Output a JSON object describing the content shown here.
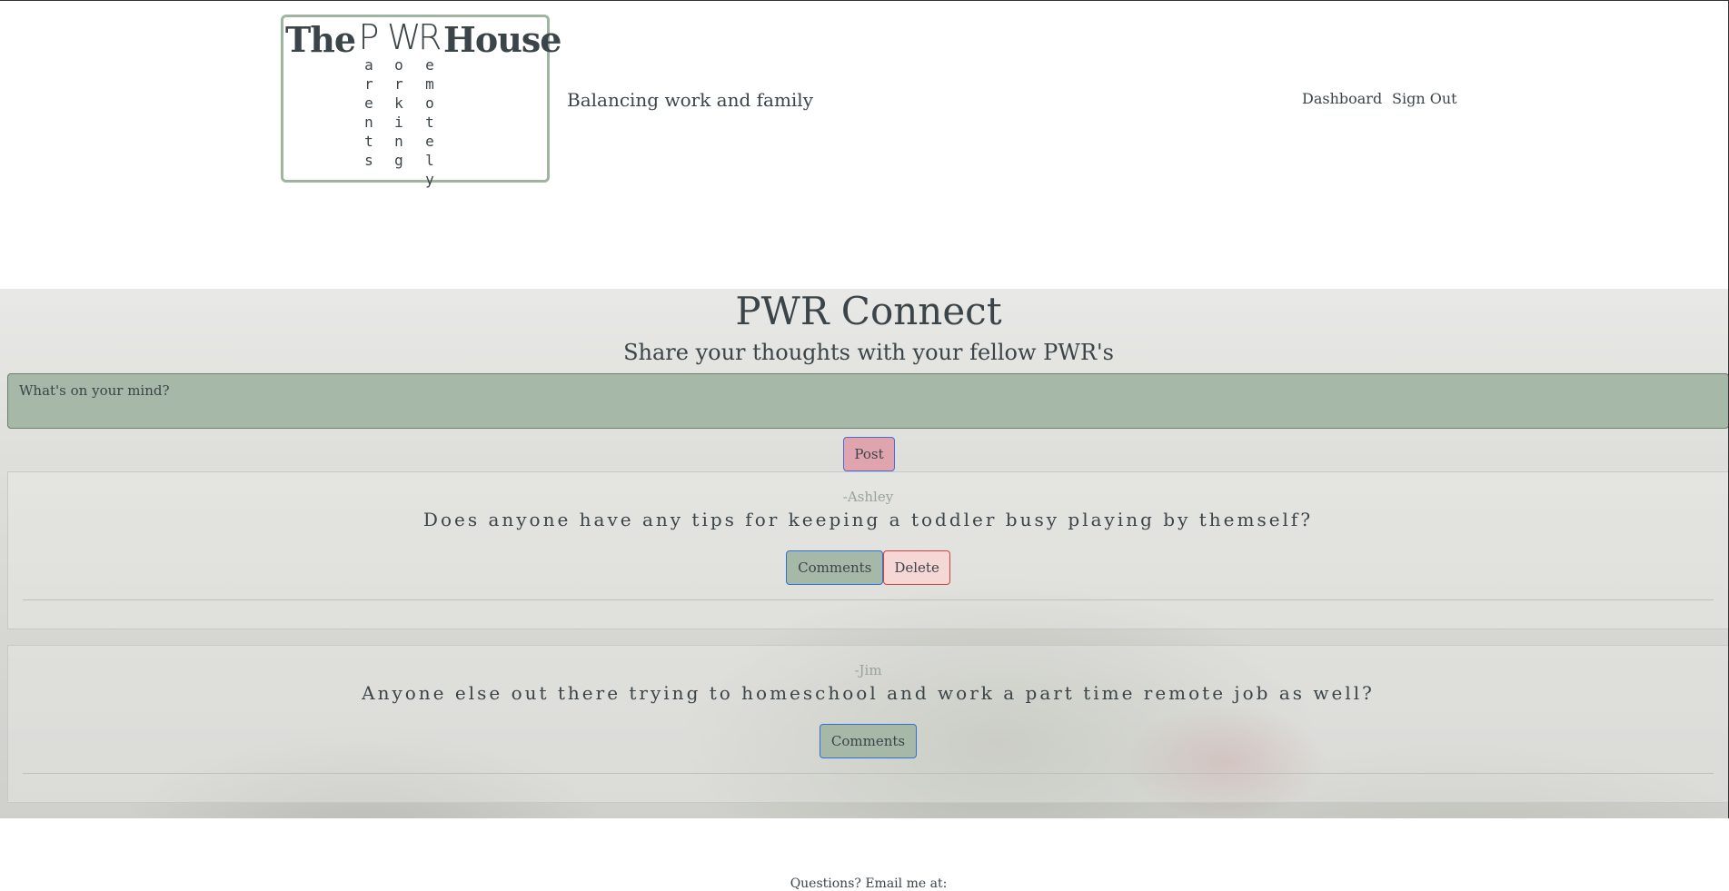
{
  "header": {
    "logo": {
      "the": "The",
      "house": "House",
      "columns": [
        {
          "letter": "P",
          "rest": "arents"
        },
        {
          "letter": "W",
          "rest": "orking"
        },
        {
          "letter": "R",
          "rest": "emotely"
        }
      ]
    },
    "tagline": "Balancing work and family",
    "nav": {
      "dashboard": "Dashboard",
      "sign_out": "Sign Out"
    }
  },
  "main": {
    "title": "PWR Connect",
    "subtitle": "Share your thoughts with your fellow PWR's",
    "post_placeholder": "What's on your mind?",
    "post_button": "Post",
    "posts": [
      {
        "author": "-Ashley",
        "text": "Does anyone have any tips for keeping a toddler busy playing by themself?",
        "comments_label": "Comments",
        "delete_label": "Delete"
      },
      {
        "author": "-Jim",
        "text": "Anyone else out there trying to homeschool and work a part time remote job as well?",
        "comments_label": "Comments"
      }
    ]
  },
  "footer": {
    "text": "Questions? Email me at:"
  }
}
